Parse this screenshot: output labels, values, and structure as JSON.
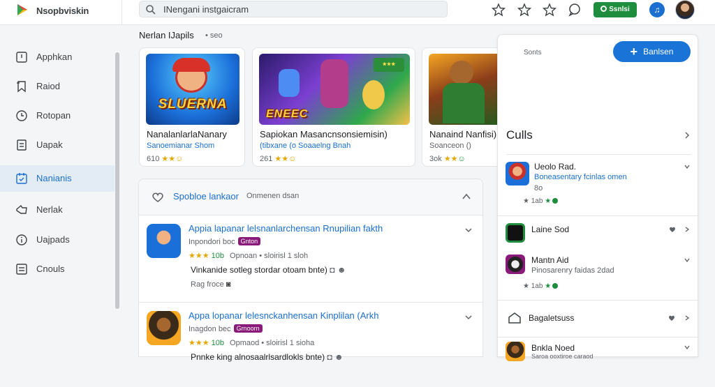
{
  "brand": {
    "name": "Nsopbviskin"
  },
  "search": {
    "value": "INengani instgaicram",
    "placeholder": ""
  },
  "install_button": {
    "label": "Ssnlsi"
  },
  "sidebar": {
    "items": [
      {
        "label": "Apphkan",
        "icon": "app-icon"
      },
      {
        "label": "Raiod",
        "icon": "bookmark-icon"
      },
      {
        "label": "Rotopan",
        "icon": "clock-icon"
      },
      {
        "label": "Uapak",
        "icon": "document-icon"
      },
      {
        "label": "Nanianis",
        "icon": "calendar-icon",
        "active": true
      },
      {
        "label": "Nerlak",
        "icon": "thumb-icon"
      },
      {
        "label": "Uajpads",
        "icon": "info-icon"
      },
      {
        "label": "Cnouls",
        "icon": "list-icon"
      }
    ]
  },
  "section": {
    "title": "Nerlan IJapils",
    "sub": "• seo"
  },
  "cards": [
    {
      "art_text": "SLUERNA",
      "title": "NanalanlarlaNanary",
      "sub": "Sanoemianar Shom",
      "meta": "610"
    },
    {
      "art_text": "ENEEC",
      "title": "Sapiokan Masancnsonsiemisin)",
      "sub": "(tibxane (o Soaaelng Bnah",
      "meta": "261"
    },
    {
      "art_text": "",
      "title": "Nanaind Nanfisi)",
      "sub": "Soanceon ()",
      "meta": "3ok"
    }
  ],
  "panel": {
    "title": "Spobloe lankaor",
    "sub": "Onmenen dsan",
    "rows": [
      {
        "title": "Appia lapanar lelsnanlarchensan Rnupilian fakth",
        "dev": "Inpondori boc",
        "tag": "Gnton",
        "rating": "10b",
        "sales": "Opnoan • sloirisl 1 sloh",
        "desc": "Vinkanide sotleg stordar otoam bnte)",
        "price": "Rag froce"
      },
      {
        "title": "Appa lopanar lelesnckanhensan Kinplilan (Arkh",
        "dev": "Inagdon bec",
        "tag": "Grnoorn",
        "rating": "10b",
        "sales": "Opmaod • sloirisl 1 sioha",
        "desc": "Pnnke king alnosaalrlsardlokls bnte)",
        "price": ""
      }
    ]
  },
  "right_panel": {
    "label": "Sonts",
    "add_button": "Banlsen",
    "title": "Culls",
    "items": [
      {
        "name": "Ueolo Rad.",
        "sub": "Boneasentary fcinlas omen",
        "ext": "8o",
        "rating": "1ab"
      },
      {
        "name": "Laine Sod",
        "sub": "",
        "ext": "",
        "rating": ""
      },
      {
        "name": "Mantn Aid",
        "sub": "Pinosarenry faidas 2dad",
        "ext": "",
        "rating": "1ab"
      }
    ],
    "bottom": {
      "label": "Bagaletsuss"
    },
    "last_item": {
      "name": "Bnkla Noed",
      "sub": "Saroa ooxtiroe caraod"
    }
  },
  "colors": {
    "accent": "#1a6fd0",
    "install": "#1e8e3e",
    "tag": "#8a1a7a",
    "star": "#e6a700"
  }
}
